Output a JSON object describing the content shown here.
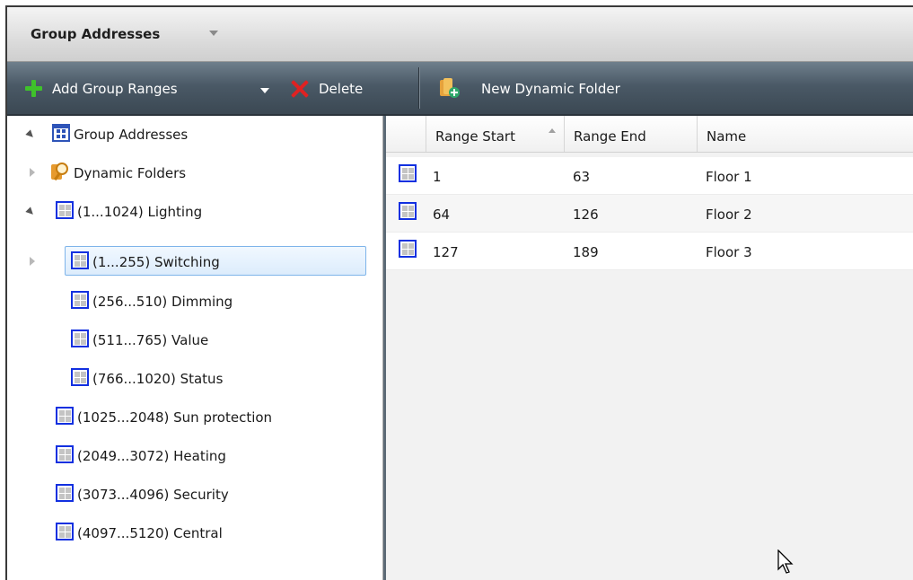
{
  "panel": {
    "title": "Group Addresses",
    "title_dropdown_icon": "chevron-down-icon"
  },
  "toolbar": {
    "add_label": "Add Group Ranges",
    "add_icon": "plus-icon",
    "delete_label": "Delete",
    "delete_icon": "x-icon",
    "new_dynamic_folder_label": "New Dynamic Folder",
    "new_dynamic_folder_icon": "dynamic-folder-add-icon"
  },
  "tree": {
    "root": "Group Addresses",
    "dynamic_folders": "Dynamic Folders",
    "lighting": "(1...1024) Lighting",
    "switching": "(1...255) Switching",
    "dimming": "(256...510) Dimming",
    "value": "(511...765) Value",
    "status": "(766...1020) Status",
    "sun_protection": "(1025...2048) Sun protection",
    "heating": "(2049...3072) Heating",
    "security": "(3073...4096) Security",
    "central": "(4097...5120) Central"
  },
  "grid": {
    "headers": {
      "range_start": "Range Start",
      "range_end": "Range End",
      "name": "Name"
    },
    "rows": [
      {
        "start": "1",
        "end": "63",
        "name": "Floor 1"
      },
      {
        "start": "64",
        "end": "126",
        "name": "Floor 2"
      },
      {
        "start": "127",
        "end": "189",
        "name": "Floor 3"
      }
    ]
  },
  "colors": {
    "toolbar_bg": "#4a5966",
    "accent_blue": "#1230e0",
    "selection": "#dcecfc",
    "add_green": "#3fc22b",
    "delete_red": "#e02222"
  }
}
